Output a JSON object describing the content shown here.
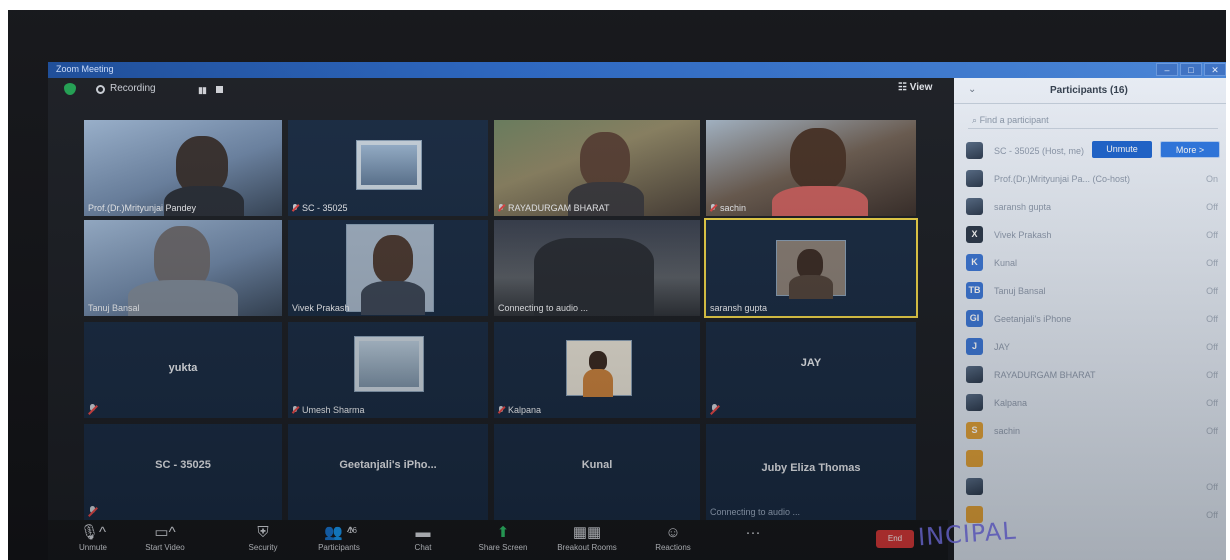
{
  "window": {
    "title": "Zoom Meeting"
  },
  "topbar": {
    "recording_label": "Recording",
    "view_label": "View"
  },
  "tiles": {
    "t1": "Prof.(Dr.)Mrityunjai Pandey",
    "t2": "SC - 35025",
    "t3": "RAYADURGAM BHARAT",
    "t4": "sachin",
    "t5": "Tanuj Bansal",
    "t6": "Vivek Prakash",
    "t7": "Connecting to audio ...",
    "t8": "saransh gupta",
    "t9": "yukta",
    "t10": "Umesh Sharma",
    "t11": "Kalpana",
    "t12": "JAY",
    "t13": "SC - 35025",
    "t14": "Geetanjali's iPho...",
    "t15": "Kunal",
    "t16": "Juby Eliza Thomas",
    "t16_status": "Connecting to audio ..."
  },
  "toolbar": {
    "unmute": "Unmute",
    "start_video": "Start Video",
    "security": "Security",
    "participants": "Participants",
    "participants_count": "16",
    "chat": "Chat",
    "share_screen": "Share Screen",
    "breakout_rooms": "Breakout Rooms",
    "reactions": "Reactions",
    "end": "End"
  },
  "panel": {
    "title": "Participants (16)",
    "search_placeholder": "Find a participant",
    "unmute_btn": "Unmute",
    "more_btn": "More >",
    "participants": [
      {
        "name": "SC - 35025 (Host, me)",
        "status": ""
      },
      {
        "name": "Prof.(Dr.)Mrityunjai Pa... (Co-host)",
        "status": "On"
      },
      {
        "name": "saransh gupta",
        "status": "Off"
      },
      {
        "name": "Vivek Prakash",
        "status": "Off"
      },
      {
        "name": "Kunal",
        "status": "Off"
      },
      {
        "name": "Tanuj Bansal",
        "status": "Off"
      },
      {
        "name": "Geetanjali's iPhone",
        "status": "Off"
      },
      {
        "name": "JAY",
        "status": "Off"
      },
      {
        "name": "RAYADURGAM BHARAT",
        "status": "Off"
      },
      {
        "name": "Kalpana",
        "status": "Off"
      },
      {
        "name": "sachin",
        "status": "Off"
      },
      {
        "name": "",
        "status": ""
      },
      {
        "name": "",
        "status": "Off"
      },
      {
        "name": "",
        "status": "Off"
      }
    ]
  },
  "stamp": "INCIPAL"
}
